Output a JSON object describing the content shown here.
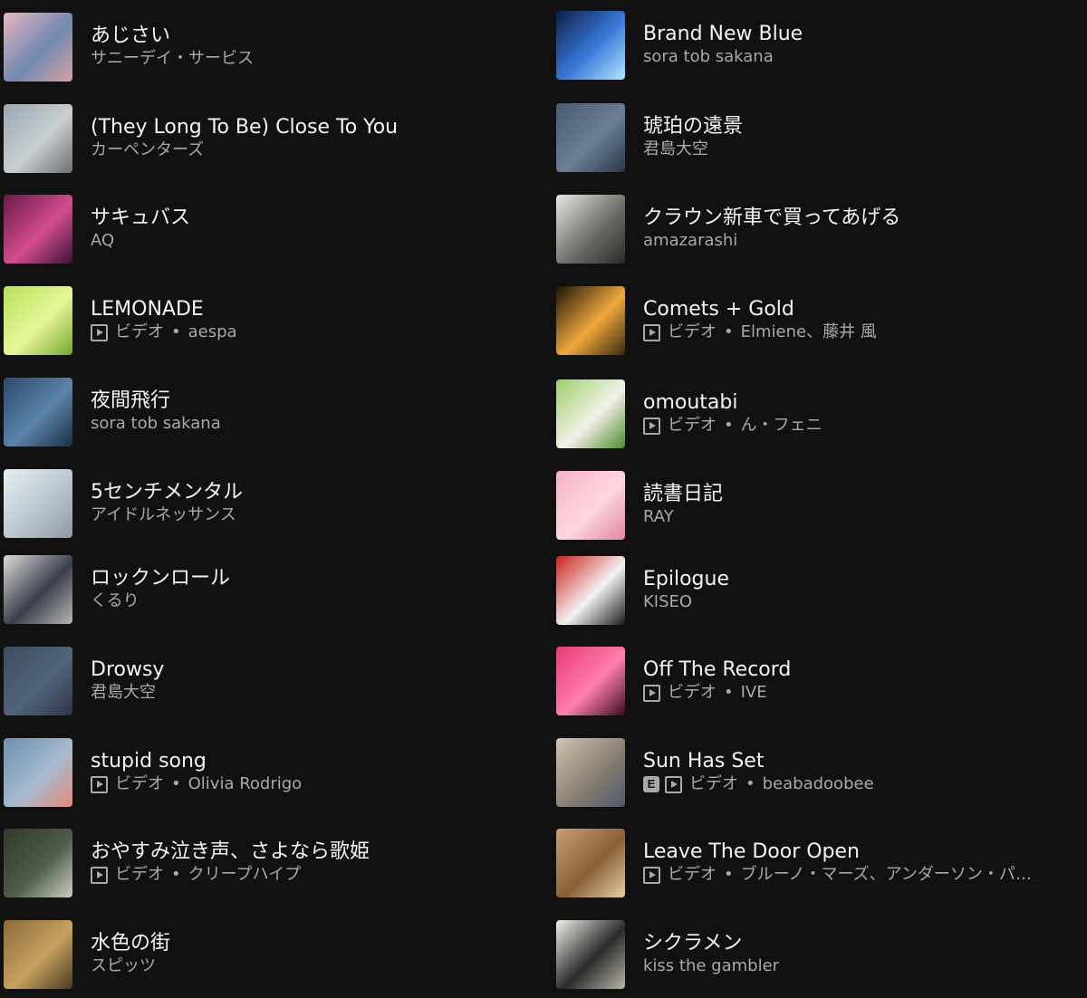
{
  "video_label": "ビデオ",
  "dot": "•",
  "explicit": "E",
  "left": [
    {
      "title": "あじさい",
      "sub": "サニーデイ・サービス",
      "video": false,
      "colors": [
        "#e8b7c2",
        "#6f8ab0",
        "#d9a0a8"
      ]
    },
    {
      "title": "(They Long To Be) Close To You",
      "sub": "カーペンターズ",
      "video": false,
      "colors": [
        "#9ea7b0",
        "#c9cfd3",
        "#6b6f75"
      ]
    },
    {
      "title": "サキュバス",
      "sub": "AQ",
      "video": false,
      "colors": [
        "#6a1a48",
        "#d24d8e",
        "#3b1338"
      ]
    },
    {
      "title": "LEMONADE",
      "sub": "aespa",
      "video": true,
      "colors": [
        "#b8e05a",
        "#e7f79a",
        "#6ea828"
      ]
    },
    {
      "title": "夜間飛行",
      "sub": "sora tob sakana",
      "video": false,
      "colors": [
        "#2a4a6e",
        "#5b83a8",
        "#1c2e44"
      ]
    },
    {
      "title": "5センチメンタル",
      "sub": "アイドルネッサンス",
      "video": false,
      "colors": [
        "#e7eef2",
        "#b9c6cf",
        "#8a9aa5"
      ]
    },
    {
      "title": "ロックンロール",
      "sub": "くるり",
      "video": false,
      "colors": [
        "#dcdcd8",
        "#3a3f4c",
        "#b7b7b2"
      ]
    },
    {
      "title": "Drowsy",
      "sub": "君島大空",
      "video": false,
      "colors": [
        "#3d4c5e",
        "#51647a",
        "#2b3646"
      ]
    },
    {
      "title": "stupid song",
      "sub": "Olivia Rodrigo",
      "video": true,
      "colors": [
        "#6d8fb0",
        "#a6bccf",
        "#e38b7b"
      ]
    },
    {
      "title": "おやすみ泣き声、さよなら歌姫",
      "sub": "クリープハイプ",
      "video": true,
      "colors": [
        "#2f3a2d",
        "#4f5b48",
        "#c9d0c2"
      ]
    },
    {
      "title": "水色の街",
      "sub": "スピッツ",
      "video": false,
      "colors": [
        "#8a6a3a",
        "#c7a15e",
        "#4a3a22"
      ]
    }
  ],
  "right": [
    {
      "title": "Brand New Blue",
      "sub": "sora tob sakana",
      "video": false,
      "explicit": false,
      "colors": [
        "#0b1e4a",
        "#3a7ad8",
        "#b2e6ff"
      ]
    },
    {
      "title": "琥珀の遠景",
      "sub": "君島大空",
      "video": false,
      "explicit": false,
      "colors": [
        "#485b70",
        "#6a7f95",
        "#2a3646"
      ]
    },
    {
      "title": "クラウン新車で買ってあげる",
      "sub": "amazarashi",
      "video": false,
      "explicit": false,
      "colors": [
        "#e8e8e4",
        "#6f6f6a",
        "#2a2a28"
      ]
    },
    {
      "title": "Comets + Gold",
      "sub": "Elmiene、藤井 風",
      "video": true,
      "explicit": false,
      "colors": [
        "#1a1208",
        "#f0a83a",
        "#3a2a12"
      ]
    },
    {
      "title": "omoutabi",
      "sub": "ん・フェニ",
      "video": true,
      "explicit": false,
      "colors": [
        "#9bd06a",
        "#f2f2e8",
        "#4f8a2e"
      ]
    },
    {
      "title": "読書日記",
      "sub": "RAY",
      "video": false,
      "explicit": false,
      "colors": [
        "#f5b3c4",
        "#ffd6e0",
        "#e0879f"
      ]
    },
    {
      "title": "Epilogue",
      "sub": "KISEO",
      "video": false,
      "explicit": false,
      "colors": [
        "#c8221c",
        "#f2f2f2",
        "#1a1a1a"
      ]
    },
    {
      "title": "Off The Record",
      "sub": "IVE",
      "video": true,
      "explicit": false,
      "colors": [
        "#e83a78",
        "#ff7fae",
        "#3a0c1e"
      ]
    },
    {
      "title": "Sun Has Set",
      "sub": "beabadoobee",
      "video": true,
      "explicit": true,
      "colors": [
        "#cfc6b6",
        "#8a7f70",
        "#4d5a6e"
      ]
    },
    {
      "title": "Leave The Door Open",
      "sub": "ブルーノ・マーズ、アンダーソン・パ…",
      "video": true,
      "explicit": false,
      "colors": [
        "#c8a072",
        "#8a5f36",
        "#e8d0a8"
      ]
    },
    {
      "title": "シクラメン",
      "sub": "kiss the gambler",
      "video": false,
      "explicit": false,
      "colors": [
        "#f2f0ea",
        "#2a2a2a",
        "#b8b4aa"
      ]
    }
  ]
}
